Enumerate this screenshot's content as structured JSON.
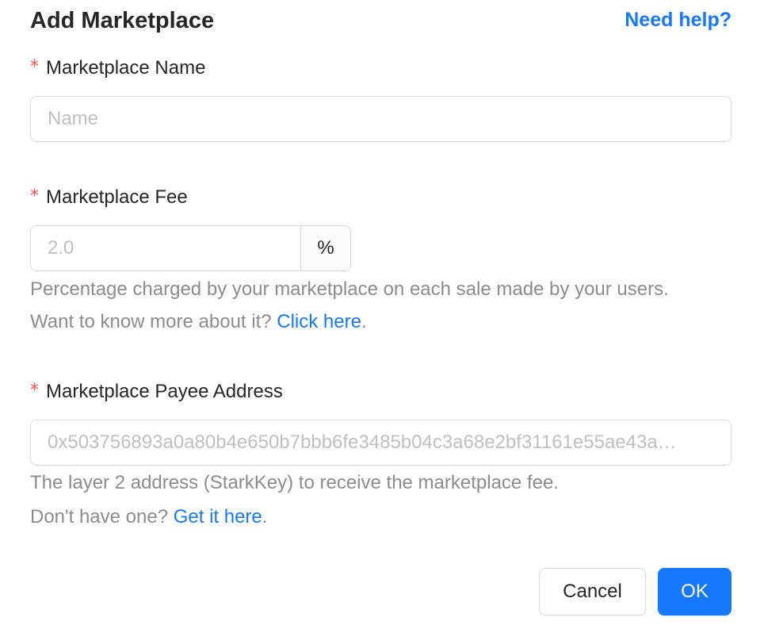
{
  "dialog": {
    "title": "Add Marketplace",
    "help_link": "Need help?"
  },
  "fields": {
    "name": {
      "label": "Marketplace Name",
      "value": "",
      "placeholder": "Name"
    },
    "fee": {
      "label": "Marketplace Fee",
      "value": "",
      "placeholder": "2.0",
      "addon": "%",
      "help_line1": "Percentage charged by your marketplace on each sale made by your users.",
      "help_line2_prefix": "Want to know more about it? ",
      "help_link": "Click here",
      "help_line2_suffix": "."
    },
    "payee": {
      "label": "Marketplace Payee Address",
      "value": "",
      "placeholder": "0x503756893a0a80b4e650b7bbb6fe3485b04c3a68e2bf31161e55ae43a…",
      "help_line1": "The layer 2 address (StarkKey) to receive the marketplace fee.",
      "help_line2_prefix": "Don't have one? ",
      "help_link": "Get it here",
      "help_line2_suffix": "."
    }
  },
  "required_mark": "*",
  "buttons": {
    "cancel": "Cancel",
    "ok": "OK"
  },
  "colors": {
    "primary": "#1677ff",
    "required": "#ff4d4f",
    "help_text": "#8c8c8c",
    "placeholder": "#bfbfbf",
    "border": "#d9d9d9"
  }
}
